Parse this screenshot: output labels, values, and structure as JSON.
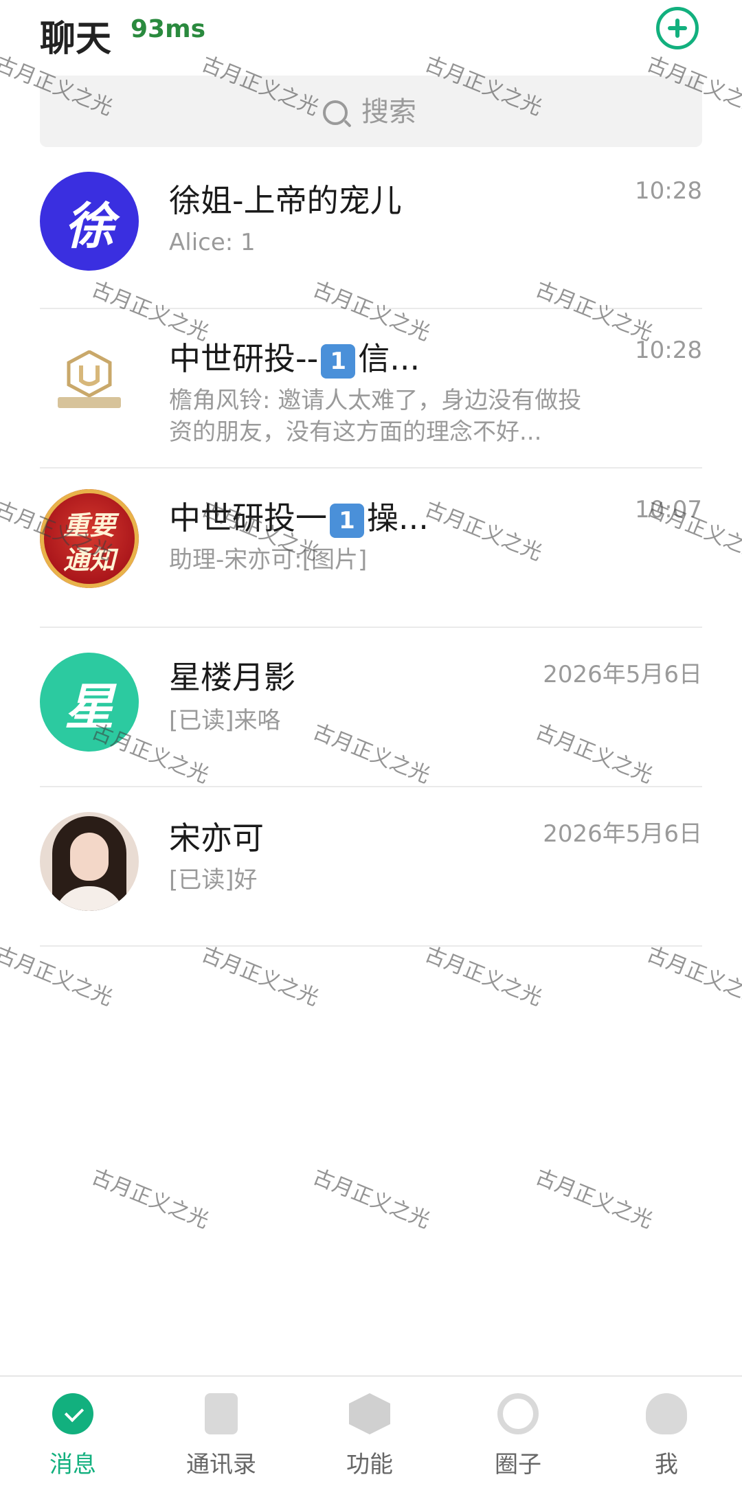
{
  "header": {
    "title": "聊天",
    "latency": "93ms",
    "add_icon": "plus-circle-icon"
  },
  "search": {
    "placeholder": "搜索",
    "icon": "search-icon"
  },
  "chats": [
    {
      "name": "徐姐-上帝的宠儿",
      "time": "10:28",
      "preview": "Alice: 1",
      "avatar_char": "徐",
      "avatar_color": "#3a2fe0"
    },
    {
      "name_prefix": "中世研投--",
      "badge": "1",
      "name_suffix": "信...",
      "time": "10:28",
      "preview": "檐角风铃: 邀请人太难了，身边没有做投资的朋友，没有这方面的理念不好..."
    },
    {
      "name_prefix": "中世研投一",
      "badge": "1",
      "name_suffix": "操...",
      "time": "10:07",
      "preview": "助理-宋亦可:[图片]",
      "avatar_line1": "重要",
      "avatar_line2": "通知"
    },
    {
      "name": "星楼月影",
      "time": "2026年5月6日",
      "preview": "[已读]来咯",
      "avatar_char": "星",
      "avatar_color": "#2ccaa0"
    },
    {
      "name": "宋亦可",
      "time": "2026年5月6日",
      "preview": "[已读]好"
    }
  ],
  "watermark": "古月正义之光",
  "bottom_nav": {
    "items": [
      {
        "label": "消息",
        "icon": "message-icon",
        "active": true
      },
      {
        "label": "通讯录",
        "icon": "contacts-icon"
      },
      {
        "label": "功能",
        "icon": "function-cube-icon"
      },
      {
        "label": "圈子",
        "icon": "circle-icon"
      },
      {
        "label": "我",
        "icon": "profile-icon"
      }
    ]
  },
  "colors": {
    "accent": "#12b07e",
    "latency": "#2a8a3e"
  }
}
